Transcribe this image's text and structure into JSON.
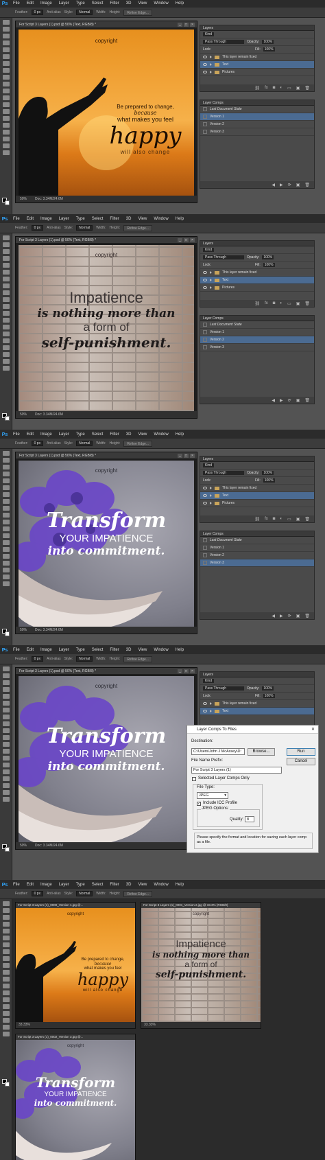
{
  "app": {
    "logo": "Ps",
    "menu": [
      "File",
      "Edit",
      "Image",
      "Layer",
      "Type",
      "Select",
      "Filter",
      "3D",
      "View",
      "Window",
      "Help"
    ]
  },
  "options_bar": {
    "feather_label": "Feather:",
    "feather_value": "0 px",
    "antialias_label": "Anti-alias",
    "style_label": "Style:",
    "style_value": "Normal",
    "width_label": "Width:",
    "height_label": "Height:",
    "refine_edge_label": "Refine Edge..."
  },
  "document": {
    "tab_title": "For Script 3 Layers (1).psd @ 50% (Text, RGB/8) *",
    "zoom": "50%",
    "doc_size": "Doc: 3.34M/24.6M"
  },
  "layers_panel": {
    "title": "Layers",
    "kind_label": "Kind",
    "blend_mode": "Pass Through",
    "opacity_label": "Opacity:",
    "opacity_value": "100%",
    "lock_label": "Lock:",
    "fill_label": "Fill:",
    "fill_value": "100%",
    "layers": [
      "This layer remain fixed",
      "Text",
      "Pictures"
    ]
  },
  "layer_comps_panel": {
    "title": "Layer Comps",
    "items": [
      "Last Document State",
      "Version 1",
      "Version 2",
      "Version 3"
    ]
  },
  "artwork": {
    "copyright": "copyright",
    "sunset": {
      "line1": "Be prepared to change,",
      "line2": "because",
      "line3": "what makes you feel",
      "line4": "happy",
      "line5": "will also change"
    },
    "brick": {
      "line1": "Impatience",
      "line2": "is nothing more than",
      "line3": "a form of",
      "line4": "self-punishment."
    },
    "flowers": {
      "line1": "Transform",
      "line2": "YOUR IMPATIENCE",
      "line3": "into commitment."
    }
  },
  "dialog": {
    "title": "Layer Comps To Files",
    "destination_label": "Destination:",
    "destination_value": "C:\\Users\\John J McAssey\\D:",
    "browse_button": "Browse...",
    "run_button": "Run",
    "cancel_button": "Cancel",
    "prefix_label": "File Name Prefix:",
    "prefix_value": "For Script 3 Layers (1)",
    "selected_only_label": "Selected Layer Comps Only",
    "file_type_group": "File Type:",
    "file_type_value": "JPEG",
    "icc_label": "Include ICC Profile",
    "jpeg_options_group": "JPEG Options:",
    "quality_label": "Quality:",
    "quality_value": "8",
    "note": "Please specify the format and location for saving each layer comp as a file."
  },
  "output_windows": {
    "win1_title": "For Script 3 Layers (1)_0000_Version 1.jpg @...",
    "win2_title": "For Script 3 Layers (1)_0001_Version 2.jpg @ 33.3% (RGB/8)",
    "win3_title": "For Script 3 Layers (1)_0002_Version 3.jpg @...",
    "zoom": "33.33%"
  },
  "colors": {
    "accent": "#31a8ff",
    "selection": "#4b6b92",
    "ui_bg": "#535353"
  }
}
